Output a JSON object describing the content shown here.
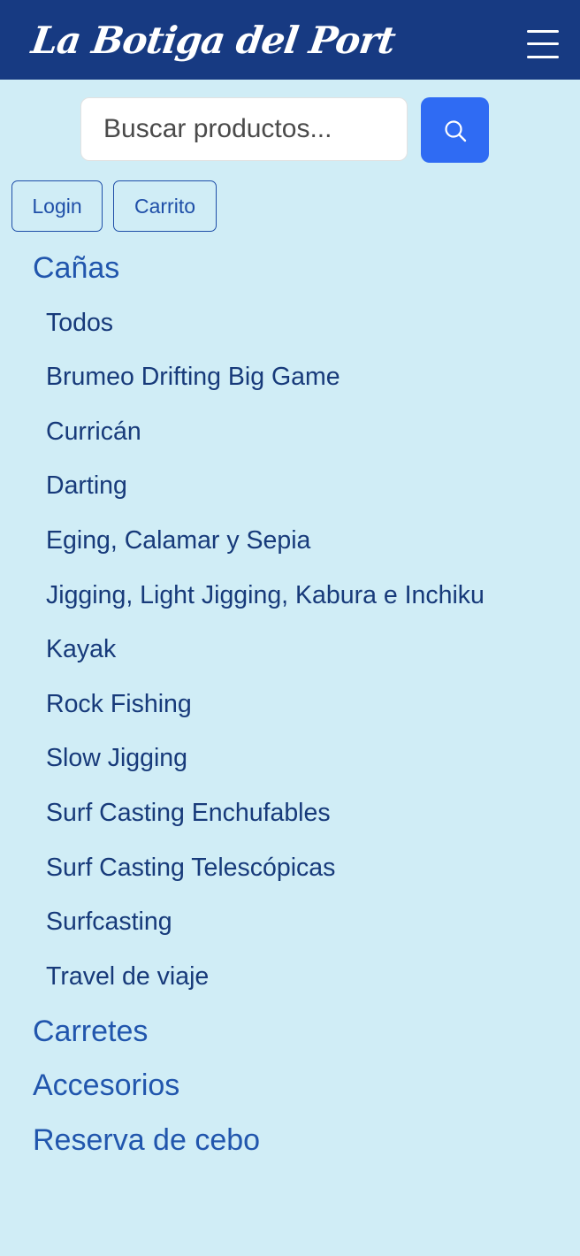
{
  "header": {
    "logo_text": "La Botiga del Port",
    "menu_icon": "hamburger-menu-icon",
    "background_color": "#173a82"
  },
  "search": {
    "placeholder": "Buscar productos...",
    "value": "",
    "button_icon": "search-icon",
    "button_color": "#2f6bf3"
  },
  "actions": {
    "login_label": "Login",
    "cart_label": "Carrito"
  },
  "categories": [
    {
      "label": "Cañas",
      "subitems": [
        "Todos",
        "Brumeo Drifting Big Game",
        "Curricán",
        "Darting",
        "Eging, Calamar y Sepia",
        "Jigging, Light Jigging, Kabura e Inchiku",
        "Kayak",
        "Rock Fishing",
        "Slow Jigging",
        "Surf Casting Enchufables",
        "Surf Casting Telescópicas",
        "Surfcasting",
        "Travel de viaje"
      ]
    },
    {
      "label": "Carretes"
    },
    {
      "label": "Accesorios"
    },
    {
      "label": "Reserva de cebo"
    }
  ],
  "colors": {
    "page_background": "#d0edf6",
    "category_text": "#2156ad",
    "subitem_text": "#173a7a"
  }
}
